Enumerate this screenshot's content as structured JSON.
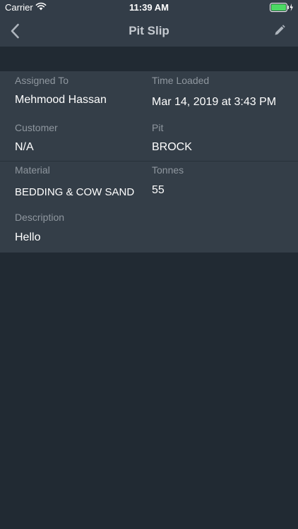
{
  "status_bar": {
    "carrier": "Carrier",
    "time": "11:39 AM",
    "wifi_icon": "wifi-icon",
    "battery_icon": "battery-charging-icon"
  },
  "nav": {
    "title": "Pit Slip",
    "back_icon": "chevron-left-icon",
    "edit_icon": "pencil-icon"
  },
  "details": {
    "assigned_to": {
      "label": "Assigned To",
      "value": "Mehmood Hassan"
    },
    "time_loaded": {
      "label": "Time Loaded",
      "value": "Mar 14, 2019 at 3:43 PM"
    },
    "customer": {
      "label": "Customer",
      "value": "N/A"
    },
    "pit": {
      "label": "Pit",
      "value": "BROCK"
    },
    "material": {
      "label": "Material",
      "value": "BEDDING & COW SAND"
    },
    "tonnes": {
      "label": "Tonnes",
      "value": "55"
    },
    "description": {
      "label": "Description",
      "value": "Hello"
    }
  },
  "colors": {
    "background": "#212a33",
    "bar": "#333d48",
    "card": "#343e48",
    "label": "#8f979f",
    "value": "#ffffff",
    "battery": "#4cd964"
  }
}
